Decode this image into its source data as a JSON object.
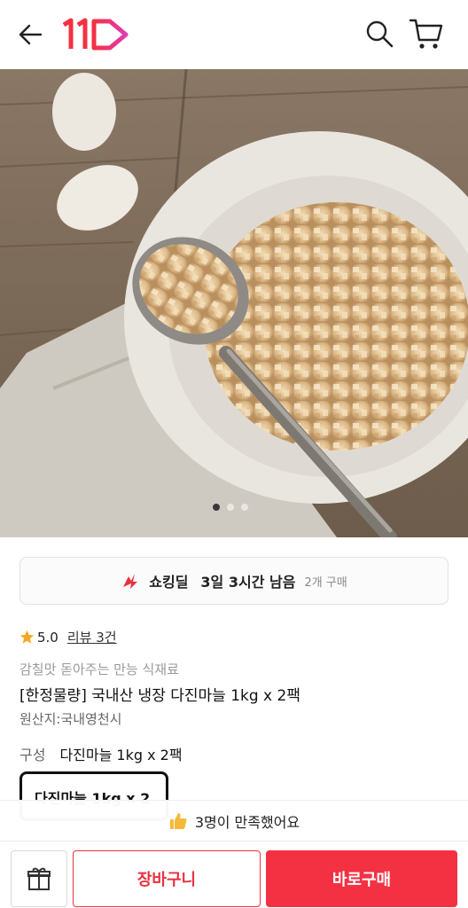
{
  "header": {
    "back_icon": "arrow-left-icon",
    "logo_text": "11",
    "search_icon": "search-icon",
    "cart_icon": "cart-icon",
    "brand_color": "#f43142"
  },
  "gallery": {
    "image_subject": "minced-garlic-photo",
    "slide_count": 3,
    "active_slide": 1
  },
  "deal": {
    "icon": "flame-lightning-icon",
    "label": "쇼킹딜",
    "time_left": "3일 3시간 남음",
    "purchase_count": "2개 구매"
  },
  "rating": {
    "star_icon": "star-icon",
    "score": "5.0",
    "review_link": "리뷰 3건"
  },
  "product": {
    "subtitle": "감칠맛 돋아주는 만능 식재료",
    "title": "[한정물량] 국내산 냉장 다진마늘 1kg x 2팩",
    "origin": "원산지:국내영천시"
  },
  "options": {
    "label": "구성",
    "value": "다진마늘 1kg x 2팩",
    "chip_label": "다진마늘 1kg x 2"
  },
  "satisfaction": {
    "icon": "thumbs-up-icon",
    "text": "3명이 만족했어요"
  },
  "bottom_bar": {
    "gift_icon": "gift-icon",
    "cart_button": "장바구니",
    "buy_button": "바로구매"
  }
}
